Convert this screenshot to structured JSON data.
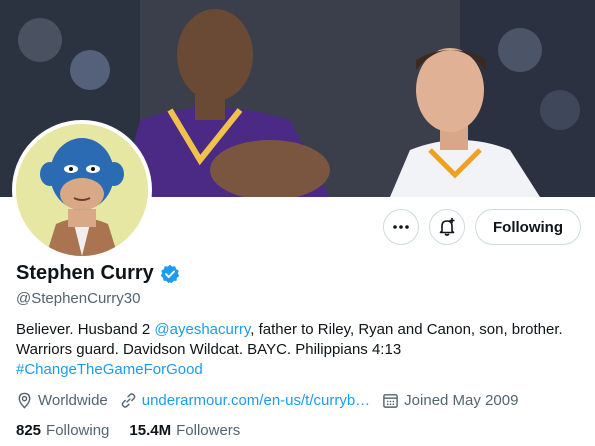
{
  "banner": {
    "image": "banner-photo"
  },
  "avatar": {
    "image": "bored-ape-avatar"
  },
  "actions": {
    "more_icon": "more-icon",
    "notify_icon": "bell-plus-icon",
    "follow_label": "Following"
  },
  "profile": {
    "name": "Stephen Curry",
    "verified_icon": "verified-badge-icon",
    "handle": "@StephenCurry30",
    "bio": {
      "part1": "Believer. Husband 2 ",
      "mention": "@ayeshacurry",
      "part2": ", father to Riley, Ryan and Canon, son, brother. Warriors guard. Davidson Wildcat. BAYC. Philippians 4:13",
      "hashtag": "#ChangeTheGameForGood"
    },
    "location": "Worldwide",
    "url": "underarmour.com/en-us/t/curryb…",
    "joined": "Joined May 2009"
  },
  "stats": {
    "following_count": "825",
    "following_label": "Following",
    "followers_count": "15.4M",
    "followers_label": "Followers"
  },
  "colors": {
    "accent": "#1d9bf0",
    "muted": "#536471",
    "text": "#0f1419"
  }
}
